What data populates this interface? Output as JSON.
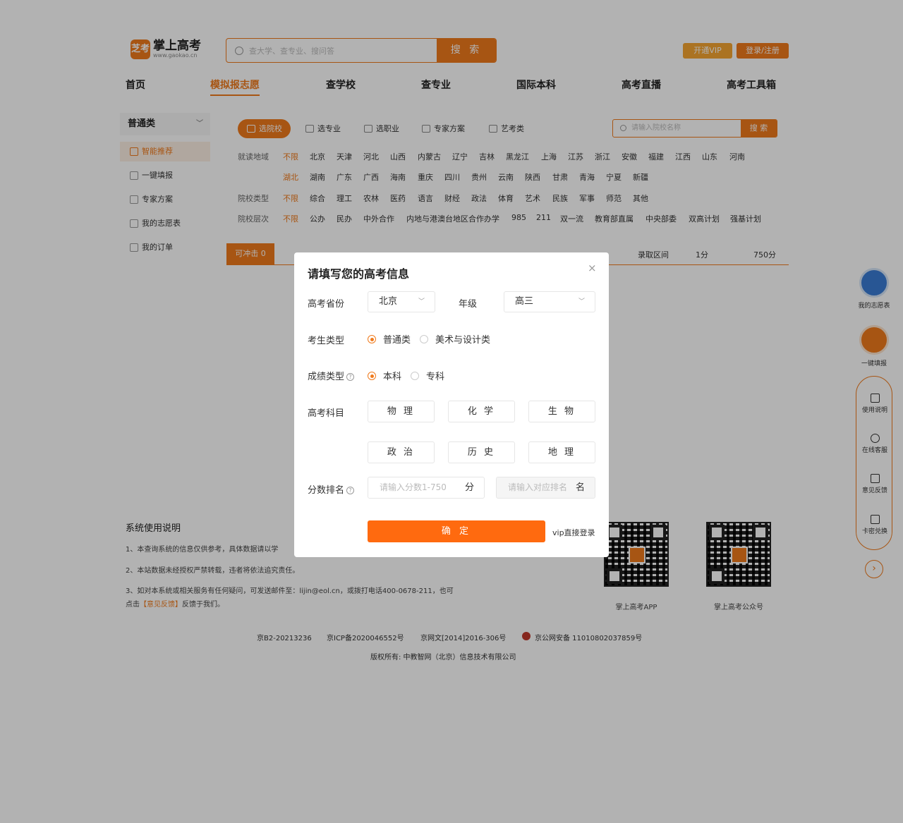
{
  "header": {
    "logo_icon": "芝考",
    "logo_title": "掌上高考",
    "logo_url": "www.gaokao.cn",
    "search_placeholder": "查大学、查专业、搜问答",
    "search_button": "搜 索",
    "vip_button": "开通VIP",
    "login_button": "登录/注册"
  },
  "nav": [
    "首页",
    "模拟报志愿",
    "查学校",
    "查专业",
    "国际本科",
    "高考直播",
    "高考工具箱"
  ],
  "sidebar": {
    "category": "普通类",
    "items": [
      "智能推荐",
      "一键填报",
      "专家方案",
      "我的志愿表",
      "我的订单"
    ]
  },
  "tabs": [
    "选院校",
    "选专业",
    "选职业",
    "专家方案",
    "艺考类"
  ],
  "school_search": {
    "placeholder": "请输入院校名称",
    "button": "搜 索"
  },
  "filters": {
    "region_label": "就读地域",
    "region_row1": [
      "不限",
      "北京",
      "天津",
      "河北",
      "山西",
      "内蒙古",
      "辽宁",
      "吉林",
      "黑龙江",
      "上海",
      "江苏",
      "浙江",
      "安徽",
      "福建",
      "江西",
      "山东",
      "河南"
    ],
    "region_row2": [
      "湖北",
      "湖南",
      "广东",
      "广西",
      "海南",
      "重庆",
      "四川",
      "贵州",
      "云南",
      "陕西",
      "甘肃",
      "青海",
      "宁夏",
      "新疆"
    ],
    "type_label": "院校类型",
    "types": [
      "不限",
      "综合",
      "理工",
      "农林",
      "医药",
      "语言",
      "财经",
      "政法",
      "体育",
      "艺术",
      "民族",
      "军事",
      "师范",
      "其他"
    ],
    "level_label": "院校层次",
    "levels": [
      "不限",
      "公办",
      "民办",
      "中外合作",
      "内地与港澳台地区合作办学",
      "985",
      "211",
      "双一流",
      "教育部直属",
      "中央部委",
      "双高计划",
      "强基计划"
    ]
  },
  "results_bar": {
    "can_rush": "可冲击 0",
    "score_range_label": "录取区间",
    "min": "1分",
    "max": "750分"
  },
  "notes": {
    "title": "系统使用说明",
    "line1": "1、本查询系统的信息仅供参考，具体数据请以学",
    "line2": "2、本站数据未经授权严禁转载，违者将依法追究责任。",
    "line3": "3、如对本系统或相关服务有任何疑问，可发送邮件至：lijin@eol.cn，或拨打电话400-0678-211，也可",
    "line4_pre": "点击",
    "line4_link": "【意见反馈】",
    "line4_post": "反馈于我们。"
  },
  "qr": {
    "app": "掌上高考APP",
    "wechat": "掌上高考公众号"
  },
  "footer": {
    "icp1": "京B2-20213236",
    "icp2": "京ICP备2020046552号",
    "icp3": "京网文[2014]2016-306号",
    "icp4": "京公网安备 11010802037859号",
    "copyright": "版权所有: 中教智网（北京）信息技术有限公司"
  },
  "float_bar": {
    "my_list": "我的志愿表",
    "one_key": "一键填报",
    "items": [
      "使用说明",
      "在线客服",
      "意见反馈",
      "卡密兑换"
    ],
    "arrow": "›"
  },
  "modal": {
    "title": "请填写您的高考信息",
    "close": "×",
    "province_label": "高考省份",
    "province_value": "北京",
    "grade_label": "年级",
    "grade_value": "高三",
    "student_type_label": "考生类型",
    "student_type_options": [
      "普通类",
      "美术与设计类"
    ],
    "score_type_label": "成绩类型",
    "score_type_options": [
      "本科",
      "专科"
    ],
    "subject_label": "高考科目",
    "subjects": [
      "物 理",
      "化 学",
      "生 物",
      "政 治",
      "历 史",
      "地 理"
    ],
    "rank_label": "分数排名",
    "score_placeholder": "请输入分数1-750",
    "score_unit": "分",
    "rank_placeholder": "请输入对应排名",
    "rank_unit": "名",
    "confirm": "确 定",
    "vip_login": "vip直接登录",
    "help_icon_text": "?"
  },
  "colors": {
    "accent": "#f07a1c",
    "button": "#ff6a0f",
    "overlay": "rgba(0,0,0,0.30)"
  }
}
